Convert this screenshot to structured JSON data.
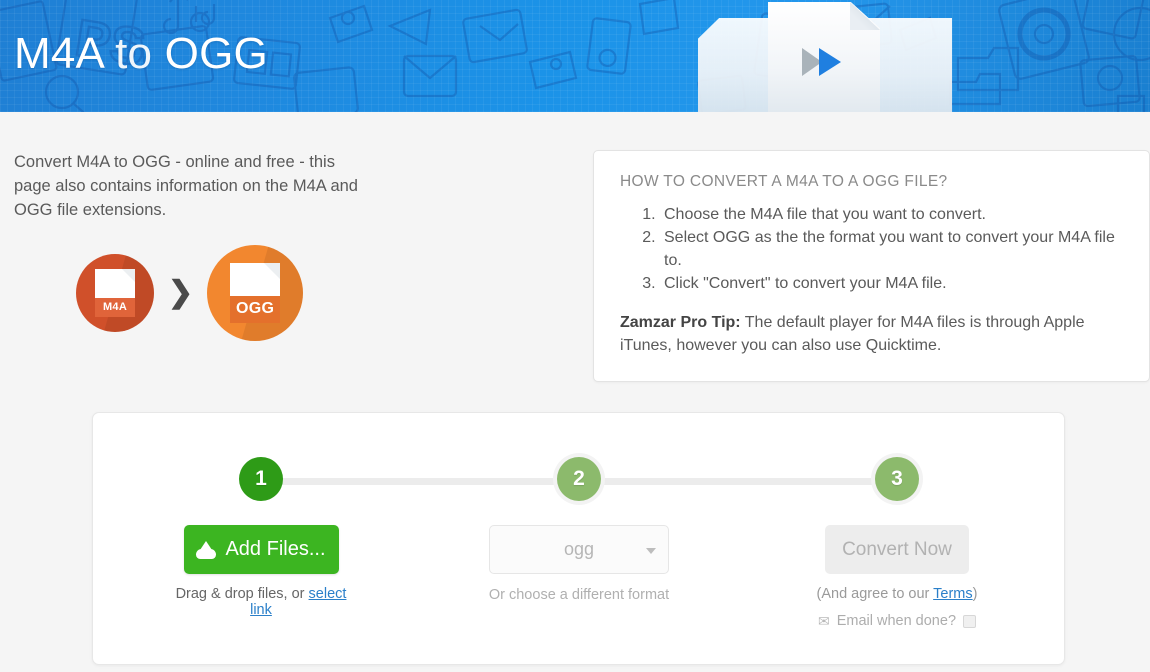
{
  "banner": {
    "title_part1": "M4A",
    "title_part2": "to",
    "title_part3": "OGG",
    "background_color": "#1b8ce0",
    "play_icon_color": "#1f7fe0"
  },
  "intro": {
    "description": "Convert M4A to OGG - online and free - this page also contains information on the M4A and OGG file extensions.",
    "source_format": "M4A",
    "target_format": "OGG",
    "arrow": "❯",
    "source_color": "#d0502a",
    "target_color": "#f2872f"
  },
  "info_panel": {
    "title": "HOW TO CONVERT A M4A TO A OGG FILE?",
    "steps": [
      "Choose the M4A file that you want to convert.",
      "Select OGG as the the format you want to convert your M4A file to.",
      "Click \"Convert\" to convert your M4A file."
    ],
    "tip_label": "Zamzar Pro Tip:",
    "tip_text": " The default player for M4A files is through Apple iTunes, however you can also use Quicktime."
  },
  "converter": {
    "steps": [
      {
        "number": "1",
        "state": "active",
        "color": "#2e9b17"
      },
      {
        "number": "2",
        "state": "inactive",
        "color": "#8cba6c"
      },
      {
        "number": "3",
        "state": "inactive",
        "color": "#8cba6c"
      }
    ],
    "add_files": {
      "label": "Add Files...",
      "icon": "upload-cloud-icon",
      "color": "#3cb521",
      "caption_prefix": "Drag & drop files, or ",
      "caption_link": "select link"
    },
    "format_select": {
      "value": "ogg",
      "caption": "Or choose a different format"
    },
    "convert": {
      "label": "Convert Now",
      "terms_prefix": "(And agree to our ",
      "terms_link": "Terms",
      "terms_suffix": ")",
      "email_icon": "✉",
      "email_label": "Email when done?",
      "email_checked": false
    }
  }
}
